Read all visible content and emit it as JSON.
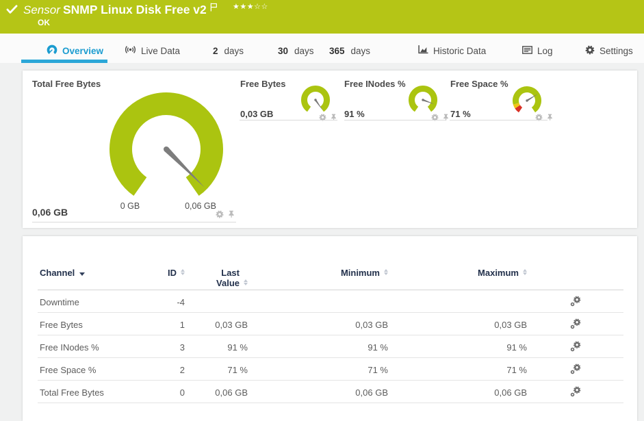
{
  "header": {
    "type_label": "Sensor",
    "title": "SNMP Linux Disk Free v2",
    "status": "OK",
    "rating_filled": "★★★",
    "rating_empty": "☆☆"
  },
  "tabs": [
    {
      "label": "Overview",
      "icon": "gauge-icon",
      "active": true
    },
    {
      "label": "Live Data",
      "icon": "broadcast-icon"
    },
    {
      "prefix": "2",
      "label": "days"
    },
    {
      "prefix": "30",
      "label": "days"
    },
    {
      "prefix": "365",
      "label": "days"
    },
    {
      "label": "Historic Data",
      "icon": "chart-icon"
    },
    {
      "label": "Log",
      "icon": "log-icon"
    },
    {
      "label": "Settings",
      "icon": "gear-icon"
    }
  ],
  "gauges": {
    "main": {
      "title": "Total Free Bytes",
      "value": "0,06 GB",
      "min_label": "0 GB",
      "max_label": "0,06 GB"
    },
    "small": [
      {
        "title": "Free Bytes",
        "value": "0,03 GB"
      },
      {
        "title": "Free INodes %",
        "value": "91 %"
      },
      {
        "title": "Free Space %",
        "value": "71 %"
      }
    ]
  },
  "table": {
    "columns": {
      "channel": "Channel",
      "id": "ID",
      "last": "Last Value",
      "min": "Minimum",
      "max": "Maximum"
    },
    "rows": [
      {
        "channel": "Downtime",
        "id": "-4",
        "last": "",
        "min": "",
        "max": ""
      },
      {
        "channel": "Free Bytes",
        "id": "1",
        "last": "0,03 GB",
        "min": "0,03 GB",
        "max": "0,03 GB"
      },
      {
        "channel": "Free INodes %",
        "id": "3",
        "last": "91 %",
        "min": "91 %",
        "max": "91 %"
      },
      {
        "channel": "Free Space %",
        "id": "2",
        "last": "71 %",
        "min": "71 %",
        "max": "71 %"
      },
      {
        "channel": "Total Free Bytes",
        "id": "0",
        "last": "0,06 GB",
        "min": "0,06 GB",
        "max": "0,06 GB"
      }
    ]
  }
}
